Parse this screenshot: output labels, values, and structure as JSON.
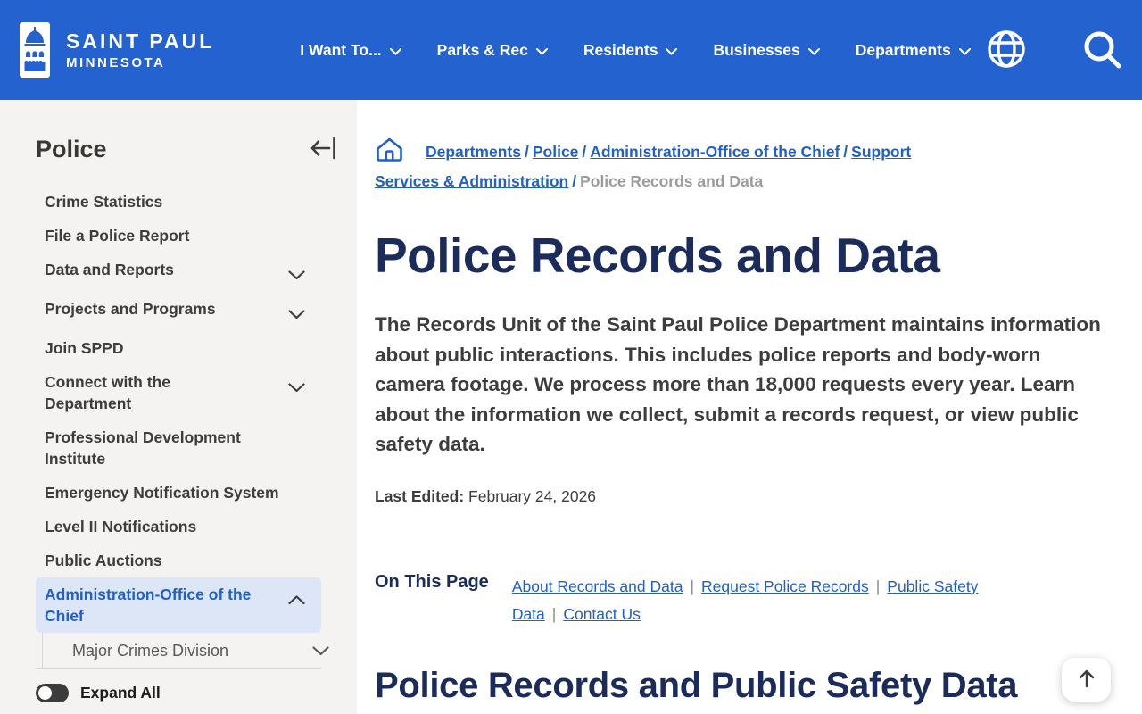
{
  "header": {
    "logo": {
      "title": "SAINT PAUL",
      "subtitle": "MINNESOTA"
    },
    "nav": [
      {
        "label": "I Want To..."
      },
      {
        "label": "Parks & Rec"
      },
      {
        "label": "Residents"
      },
      {
        "label": "Businesses"
      },
      {
        "label": "Departments"
      }
    ]
  },
  "sidebar": {
    "title": "Police",
    "items": [
      {
        "label": "Crime Statistics"
      },
      {
        "label": "File a Police Report"
      },
      {
        "label": "Data and Reports"
      },
      {
        "label": "Projects and Programs"
      },
      {
        "label": "Join SPPD"
      },
      {
        "label": "Connect with the Department"
      },
      {
        "label": "Professional Development Institute"
      },
      {
        "label": "Emergency Notification System"
      },
      {
        "label": "Level II Notifications"
      },
      {
        "label": "Public Auctions"
      },
      {
        "label": "Administration-Office of the Chief"
      }
    ],
    "subitem": {
      "label": "Major Crimes Division"
    },
    "expand_all_label": "Expand All"
  },
  "breadcrumb": {
    "separator": "/",
    "links": [
      {
        "label": "Departments"
      },
      {
        "label": "Police"
      },
      {
        "label": "Administration-Office of the Chief"
      },
      {
        "label": "Support Services & Administration"
      }
    ],
    "current": "Police Records and Data"
  },
  "main": {
    "title": "Police Records and Data",
    "lead": "The Records Unit of the Saint Paul Police Department maintains information about public interactions. This includes police reports and body-worn camera footage. We process more than 18,000 requests every year. Learn about the information we collect, submit a records request, or view public safety data.",
    "last_edited_label": "Last Edited:",
    "last_edited_value": "February 24, 2026",
    "on_this_page": {
      "label": "On This Page",
      "separator": "|",
      "links": [
        {
          "label": "About Records and Data"
        },
        {
          "label": "Request Police Records"
        },
        {
          "label": "Public Safety Data"
        },
        {
          "label": "Contact Us"
        }
      ]
    },
    "section_heading": "Police Records and Public Safety Data"
  },
  "colors": {
    "header_blue": "#2463cf",
    "link_blue": "#2160c9",
    "heading_navy": "#1b2b5a",
    "sidebar_bg": "#f4f3f1",
    "active_item_bg": "#dce6f6",
    "body_text": "#3d3d3d"
  }
}
